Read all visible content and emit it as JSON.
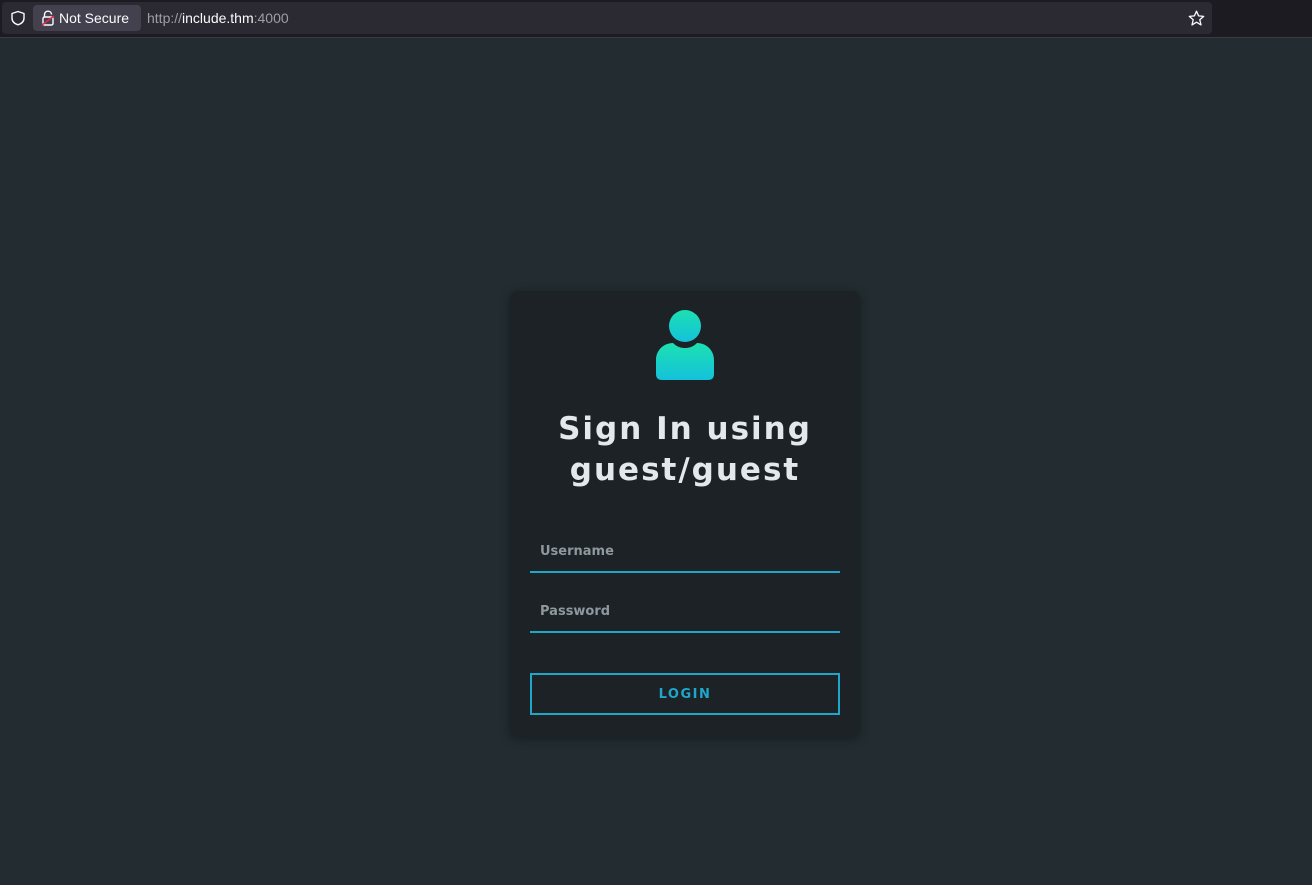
{
  "browser": {
    "security_label": "Not Secure",
    "url_scheme": "http://",
    "url_host": "include.thm",
    "url_port": ":4000",
    "icons": [
      "shield-icon",
      "insecure-lock-icon",
      "bookmark-star-icon"
    ]
  },
  "login": {
    "title_line1": "Sign In using",
    "title_line2": "guest/guest",
    "username_placeholder": "Username",
    "password_placeholder": "Password",
    "button_label": "LOGIN",
    "avatar_icon": "user-avatar-icon"
  },
  "colors": {
    "background": "#222c31",
    "card": "#1c2226",
    "accent": "#1fa6c9",
    "avatar_gradient_top": "#1de0b0",
    "avatar_gradient_bottom": "#13c2dc"
  }
}
